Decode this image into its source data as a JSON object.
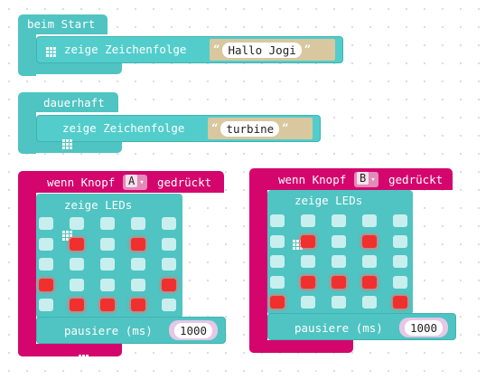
{
  "blocks": {
    "on_start": {
      "hat_label": "beim Start",
      "statement_label": "zeige Zeichenfolge",
      "string_value": "Hallo Jogi",
      "open_quote": "“",
      "close_quote": "”"
    },
    "forever": {
      "hat_label": "dauerhaft",
      "statement_label": "zeige Zeichenfolge",
      "string_value": "turbine",
      "open_quote": "“",
      "close_quote": "”"
    },
    "button_a": {
      "hat_prefix": "wenn Knopf",
      "button_value": "A",
      "dropdown_arrow": "▾",
      "hat_suffix": "gedrückt",
      "leds_label": "zeige LEDs",
      "leds": [
        [
          0,
          0,
          0,
          0,
          0
        ],
        [
          0,
          1,
          0,
          1,
          0
        ],
        [
          0,
          0,
          0,
          0,
          0
        ],
        [
          1,
          0,
          0,
          0,
          1
        ],
        [
          0,
          1,
          1,
          1,
          0
        ]
      ],
      "pause_label": "pausiere (ms)",
      "pause_value": "1000"
    },
    "button_b": {
      "hat_prefix": "wenn Knopf",
      "button_value": "B",
      "dropdown_arrow": "▾",
      "hat_suffix": "gedrückt",
      "leds_label": "zeige LEDs",
      "leds": [
        [
          0,
          0,
          0,
          0,
          0
        ],
        [
          0,
          1,
          0,
          1,
          0
        ],
        [
          0,
          0,
          0,
          0,
          0
        ],
        [
          0,
          1,
          1,
          1,
          0
        ],
        [
          1,
          0,
          0,
          0,
          1
        ]
      ],
      "pause_label": "pausiere (ms)",
      "pause_value": "1000"
    }
  },
  "colors": {
    "basic_block": "#4fc4c2",
    "input_block": "#d4066e",
    "led_on": "#f0302e",
    "led_off": "#c8efee",
    "string_slot": "#d9c79f",
    "number_slot": "#e5c7e6"
  },
  "icons": {
    "basic_category": "grid-icon",
    "input_category": "circle-dot-icon"
  }
}
